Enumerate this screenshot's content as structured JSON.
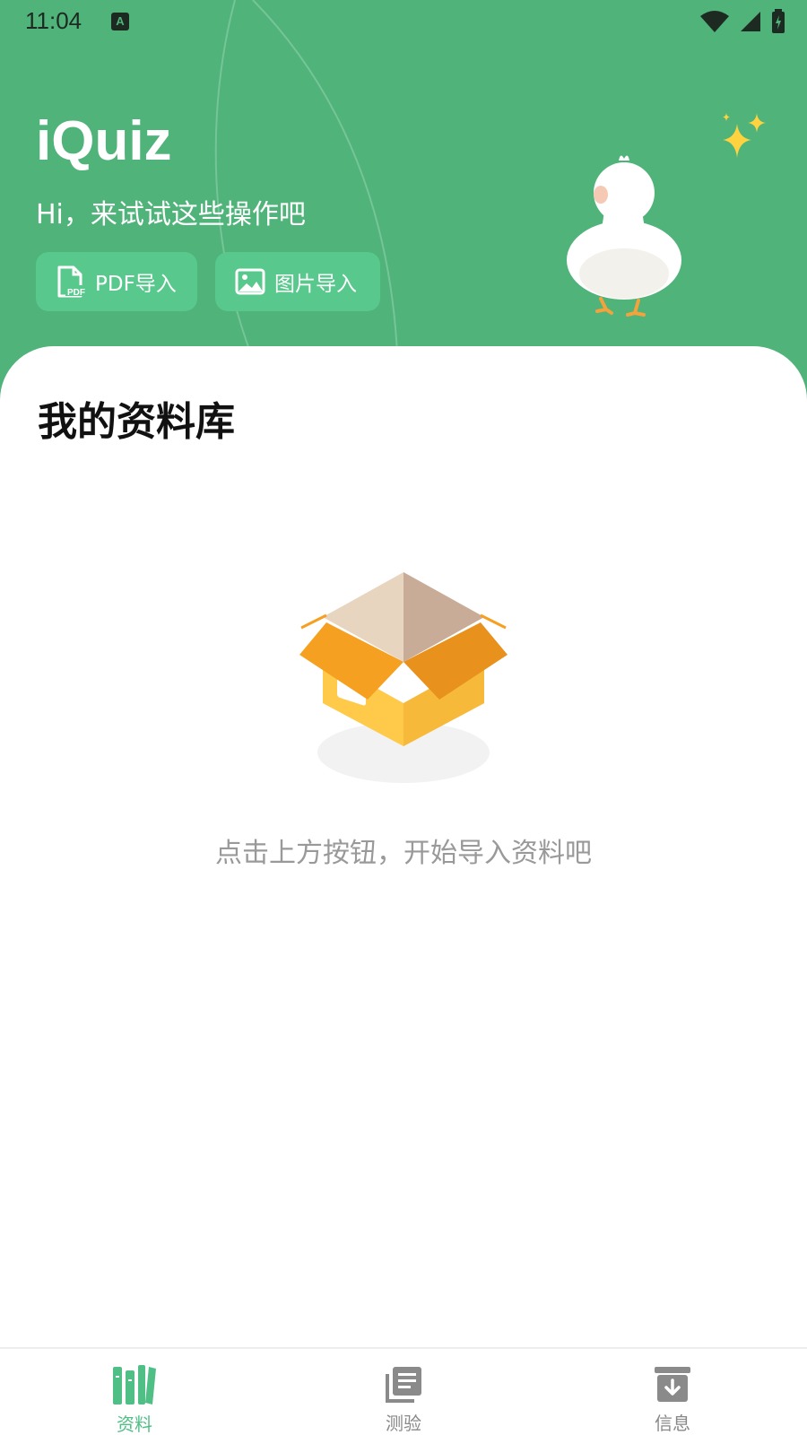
{
  "status_bar": {
    "time": "11:04",
    "notification_icon": "A"
  },
  "header": {
    "app_title": "iQuiz",
    "subtitle": "Hi，来试试这些操作吧",
    "buttons": [
      {
        "label": "PDF导入",
        "icon": "pdf-file-icon"
      },
      {
        "label": "图片导入",
        "icon": "image-icon"
      }
    ]
  },
  "library": {
    "title": "我的资料库",
    "empty_message": "点击上方按钮，开始导入资料吧"
  },
  "bottom_nav": {
    "items": [
      {
        "label": "资料",
        "icon": "books-icon",
        "active": true
      },
      {
        "label": "测验",
        "icon": "document-stack-icon",
        "active": false
      },
      {
        "label": "信息",
        "icon": "archive-download-icon",
        "active": false
      }
    ]
  },
  "colors": {
    "header_bg": "#4fb37a",
    "button_bg": "#58c88d",
    "active_tab": "#4fbf86",
    "inactive_tab": "#888888"
  }
}
